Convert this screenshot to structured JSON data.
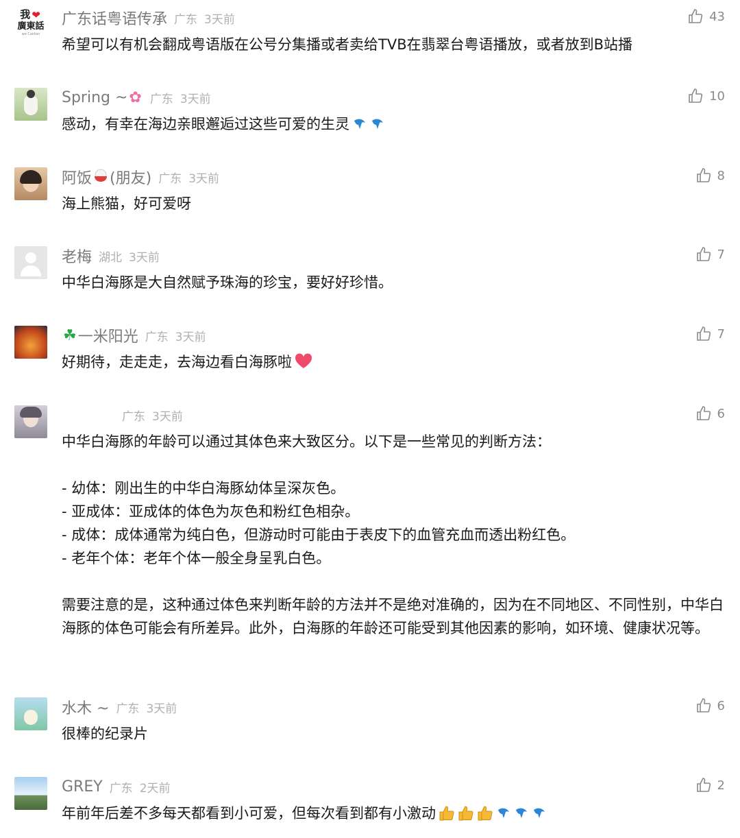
{
  "comments": [
    {
      "name": "广东话粤语传承",
      "location": "广东",
      "time": "3天前",
      "likes": "43",
      "text": "希望可以有机会翻成粤语版在公号分集播或者卖给TVB在翡翠台粤语播放，或者放到B站播",
      "avatar_text_top": "我",
      "avatar_text_bottom": "廣東話",
      "avatar_text_small": "we Canton"
    },
    {
      "name": "Spring ~",
      "location": "广东",
      "time": "3天前",
      "likes": "10",
      "text": "感动，有幸在海边亲眼邂逅过这些可爱的生灵"
    },
    {
      "name": "阿饭",
      "name_suffix": "(朋友)",
      "location": "广东",
      "time": "3天前",
      "likes": "8",
      "text": "海上熊猫，好可爱呀"
    },
    {
      "name": "老梅",
      "location": "湖北",
      "time": "3天前",
      "likes": "7",
      "text": "中华白海豚是大自然赋予珠海的珍宝，要好好珍惜。"
    },
    {
      "name": "一米阳光",
      "location": "广东",
      "time": "3天前",
      "likes": "7",
      "text": "好期待，走走走，去海边看白海豚啦"
    },
    {
      "name": "",
      "location": "广东",
      "time": "3天前",
      "likes": "6",
      "text": "中华白海豚的年龄可以通过其体色来大致区分。以下是一些常见的判断方法：\n\n- 幼体：刚出生的中华白海豚幼体呈深灰色。\n- 亚成体：亚成体的体色为灰色和粉红色相杂。\n- 成体：成体通常为纯白色，但游动时可能由于表皮下的血管充血而透出粉红色。\n- 老年个体：老年个体一般全身呈乳白色。\n\n需要注意的是，这种通过体色来判断年龄的方法并不是绝对准确的，因为在不同地区、不同性别，中华白海豚的体色可能会有所差异。此外，白海豚的年龄还可能受到其他因素的影响，如环境、健康状况等。"
    },
    {
      "name": "水木 ~",
      "location": "广东",
      "time": "3天前",
      "likes": "6",
      "text": "很棒的纪录片"
    },
    {
      "name": "GREY",
      "location": "广东",
      "time": "2天前",
      "likes": "2",
      "text": "年前年后差不多每天都看到小可爱，但每次看到都有小激动"
    }
  ]
}
